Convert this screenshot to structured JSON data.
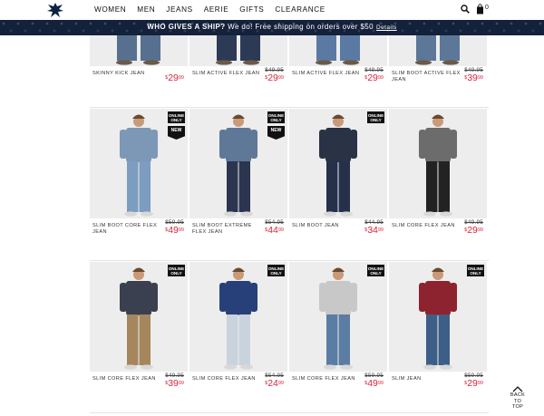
{
  "nav": {
    "items": [
      "WOMEN",
      "MEN",
      "JEANS",
      "AERIE",
      "GIFTS",
      "CLEARANCE"
    ],
    "bag_count": "0"
  },
  "promo": {
    "lead": "WHO GIVES A SHIP?",
    "text": " We do! Free shipping on orders over $50",
    "details": "Details"
  },
  "rows": [
    {
      "products": [
        {
          "name": "SKINNY KICK JEAN",
          "was": "",
          "now_dollars": "29",
          "now_cents": "99",
          "online": false,
          "new": false
        },
        {
          "name": "SLIM ACTIVE FLEX JEAN",
          "was": "$49.95",
          "now_dollars": "29",
          "now_cents": "99",
          "online": false,
          "new": false
        },
        {
          "name": "SLIM ACTIVE FLEX JEAN",
          "was": "$49.95",
          "now_dollars": "29",
          "now_cents": "99",
          "online": false,
          "new": false
        },
        {
          "name": "SLIM BOOT ACTIVE FLEX JEAN",
          "was": "$49.95",
          "now_dollars": "39",
          "now_cents": "99",
          "online": false,
          "new": false
        }
      ]
    },
    {
      "products": [
        {
          "name": "SLIM BOOT CORE FLEX JEAN",
          "was": "$59.95",
          "now_dollars": "49",
          "now_cents": "99",
          "online": true,
          "new": true
        },
        {
          "name": "SLIM BOOT EXTREME FLEX JEAN",
          "was": "$54.95",
          "now_dollars": "44",
          "now_cents": "99",
          "online": true,
          "new": true
        },
        {
          "name": "SLIM BOOT JEAN",
          "was": "$44.95",
          "now_dollars": "34",
          "now_cents": "99",
          "online": true,
          "new": false
        },
        {
          "name": "SLIM CORE FLEX JEAN",
          "was": "$49.95",
          "now_dollars": "29",
          "now_cents": "99",
          "online": false,
          "new": false
        }
      ]
    },
    {
      "products": [
        {
          "name": "SLIM CORE FLEX JEAN",
          "was": "$49.95",
          "now_dollars": "39",
          "now_cents": "99",
          "online": true,
          "new": false
        },
        {
          "name": "SLIM CORE FLEX JEAN",
          "was": "$54.95",
          "now_dollars": "24",
          "now_cents": "99",
          "online": true,
          "new": false
        },
        {
          "name": "SLIM CORE FLEX JEAN",
          "was": "$59.95",
          "now_dollars": "49",
          "now_cents": "99",
          "online": true,
          "new": false
        },
        {
          "name": "SLIM JEAN",
          "was": "$59.95",
          "now_dollars": "29",
          "now_cents": "99",
          "online": true,
          "new": false
        }
      ]
    }
  ],
  "badges": {
    "online": "ONLINE ONLY",
    "new": "NEW"
  },
  "currency": "$",
  "back_to_top": [
    "BACK",
    "TO",
    "TOP"
  ],
  "colors": {
    "promo_bg": "#13213a",
    "sale_red": "#d6263c",
    "badge_black": "#111111"
  },
  "icons": {
    "logo": "eagle-logo-icon",
    "search": "search-icon",
    "bag": "shopping-bag-icon",
    "back_to_top": "chevron-up-icon"
  }
}
